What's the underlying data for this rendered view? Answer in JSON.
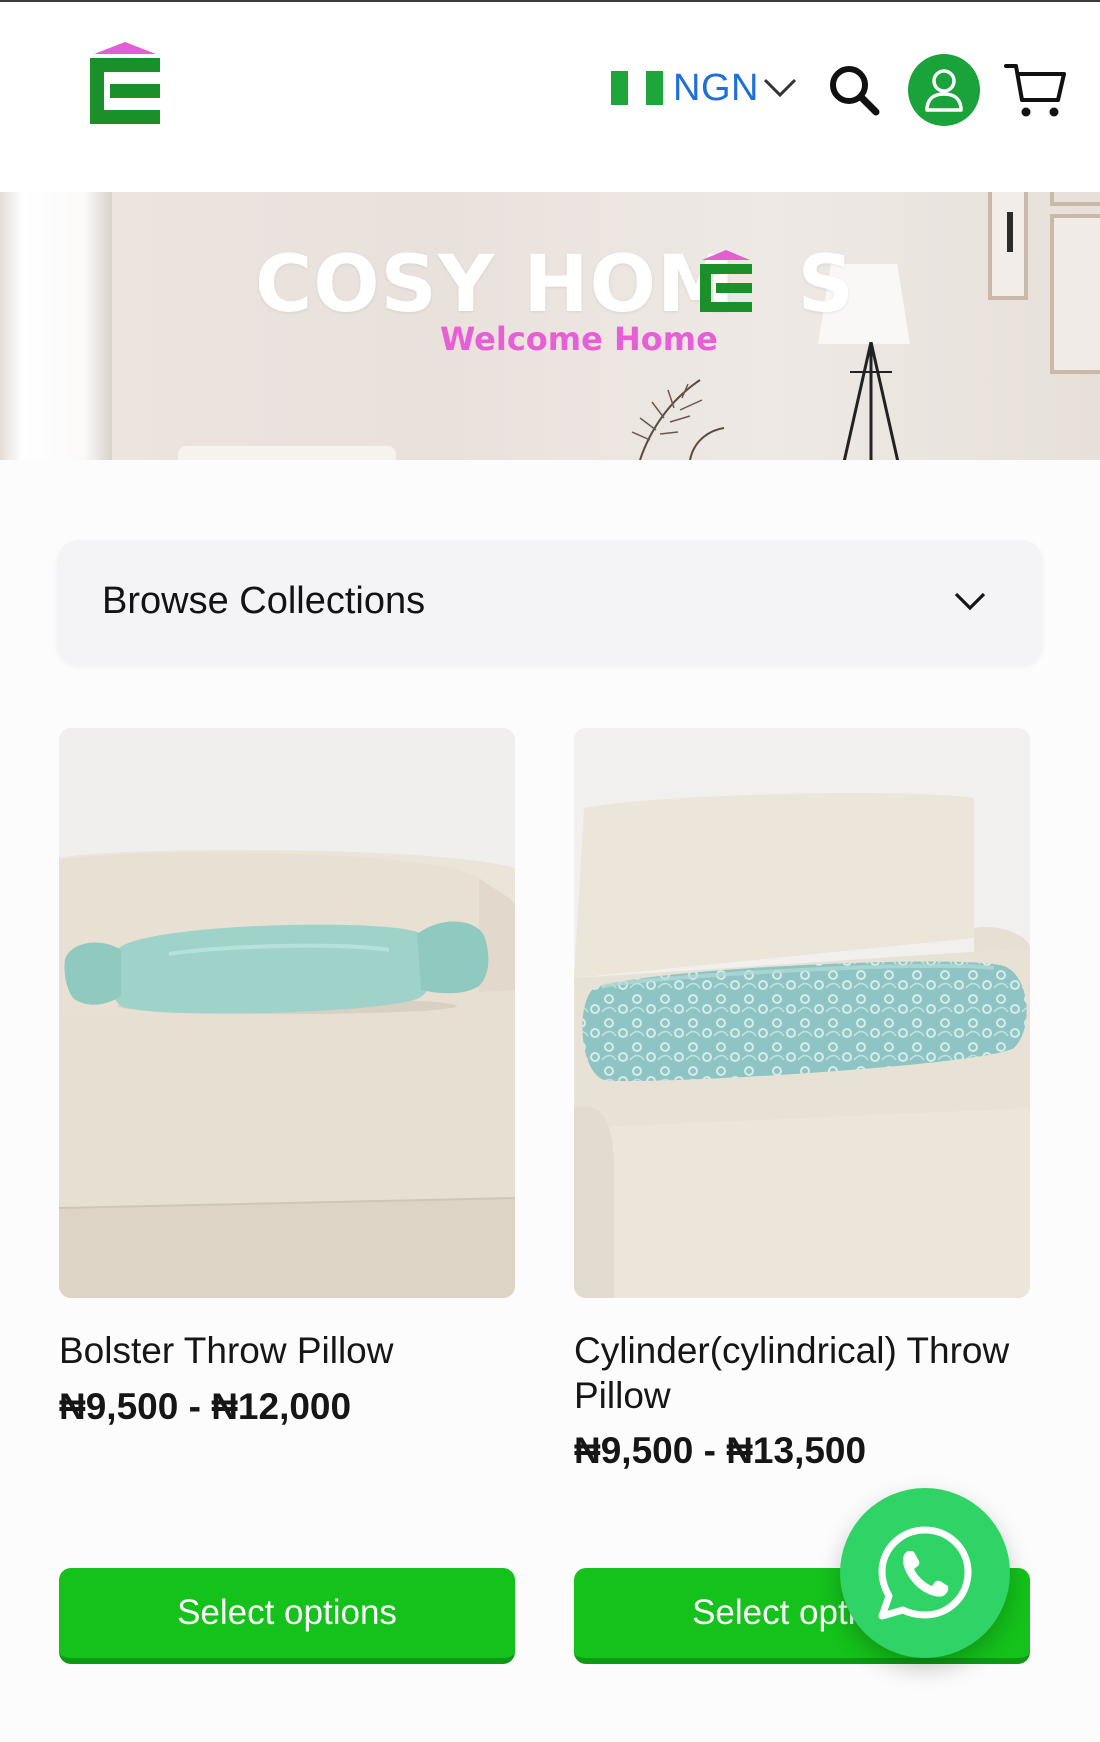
{
  "header": {
    "currency": {
      "code": "NGN",
      "flag_colors": [
        "#1fa63a",
        "#ffffff",
        "#1fa63a"
      ]
    },
    "icons": [
      "logo-icon",
      "nigeria-flag-icon",
      "chevron-down-icon",
      "search-icon",
      "user-icon",
      "cart-icon"
    ]
  },
  "hero": {
    "title_part1": "COSY HOM",
    "title_part2": "S",
    "subtitle": "Welcome Home"
  },
  "browse": {
    "label": "Browse Collections"
  },
  "products": [
    {
      "name": "Bolster Throw Pillow",
      "price": "₦9,500 - ₦12,000",
      "button": "Select options",
      "pillow_color": "#9fd3ca"
    },
    {
      "name": "Cylinder(cylindrical) Throw Pillow",
      "price": "₦9,500 - ₦13,500",
      "button": "Select options",
      "pillow_color": "#8fc5c4"
    }
  ],
  "colors": {
    "brand_green": "#1a8f2a",
    "brand_pink": "#e85fd5",
    "button_green": "#14c21b",
    "currency_blue": "#1f6fd9",
    "account_green": "#1aa33a",
    "whatsapp_green": "#2fd366"
  },
  "whatsapp": {
    "icon": "whatsapp-icon"
  }
}
